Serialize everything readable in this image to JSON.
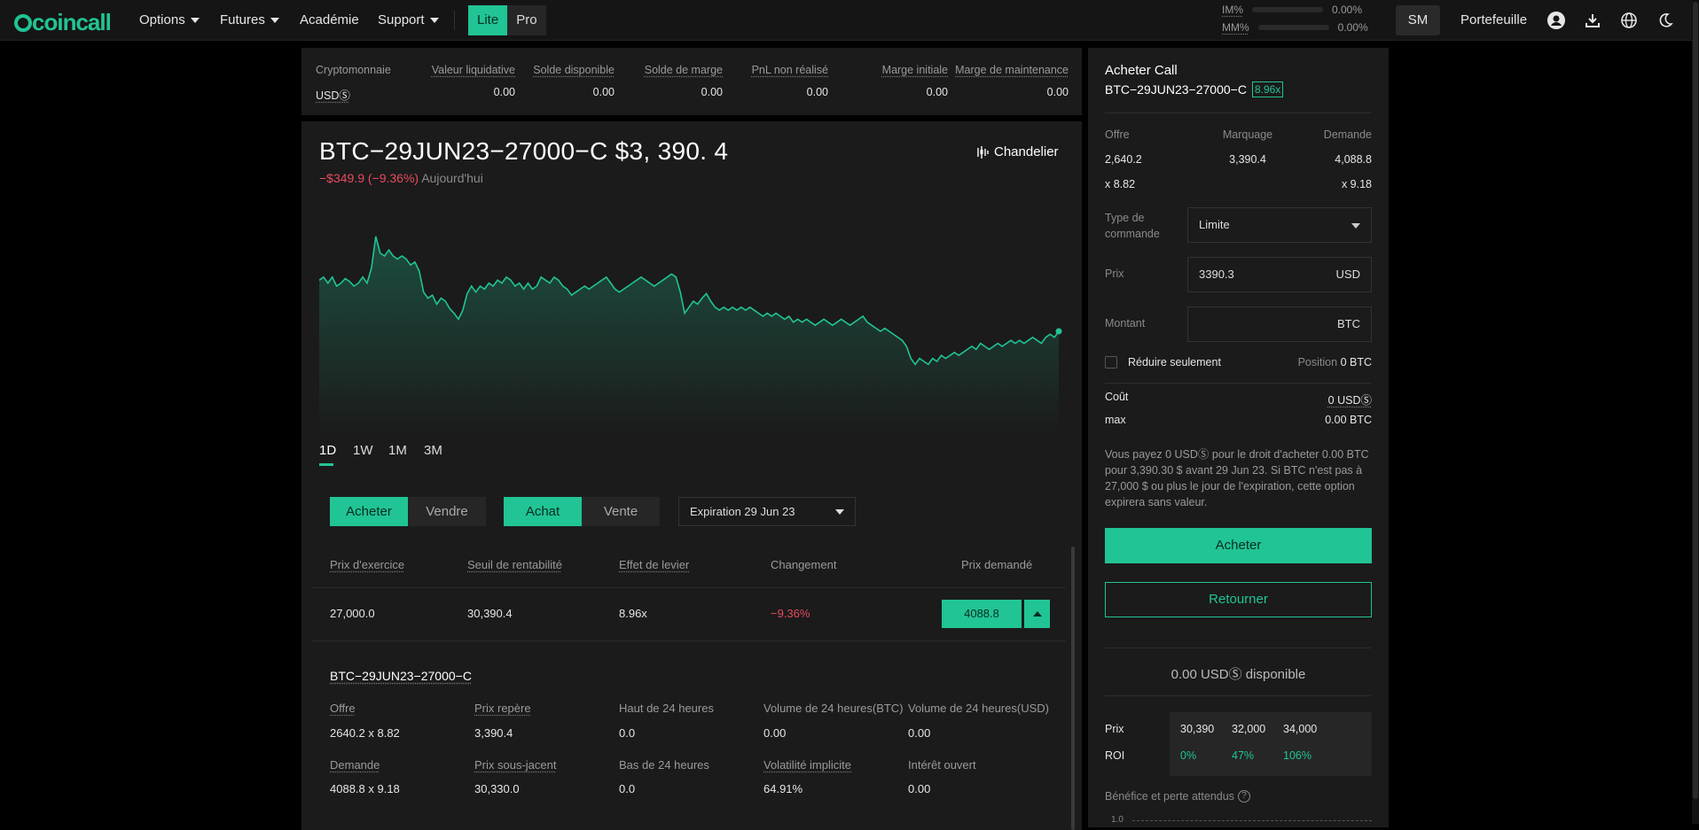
{
  "nav": {
    "brand": "coincall",
    "items": [
      {
        "label": "Options",
        "has_caret": true
      },
      {
        "label": "Futures",
        "has_caret": true
      },
      {
        "label": "Académie",
        "has_caret": false
      },
      {
        "label": "Support",
        "has_caret": true
      }
    ],
    "mode_lite": "Lite",
    "mode_pro": "Pro",
    "im_label": "IM%",
    "im_value": "0.00%",
    "mm_label": "MM%",
    "mm_value": "0.00%",
    "user_initials": "SM",
    "portfolio": "Portefeuille",
    "icons": [
      "user-icon",
      "download-icon",
      "globe-icon",
      "moon-icon"
    ]
  },
  "balances": {
    "headers": [
      "Cryptomonnaie",
      "Valeur liquidative",
      "Solde disponible",
      "Solde de marge",
      "PnL non réalisé",
      "Marge initiale",
      "Marge de maintenance"
    ],
    "values": [
      "USDⓈ",
      "0.00",
      "0.00",
      "0.00",
      "0.00",
      "0.00",
      "0.00"
    ]
  },
  "instrument": {
    "name": "BTC−29JUN23−27000−C",
    "price": "$3, 390. 4",
    "change": "−$349.9 (−9.36%)",
    "change_period": "Aujourd'hui",
    "chart_mode": "Chandelier"
  },
  "chart_data": {
    "type": "area",
    "color": "#21c495",
    "values": [
      0.64,
      0.66,
      0.62,
      0.66,
      0.6,
      0.62,
      0.65,
      0.63,
      0.6,
      0.62,
      0.66,
      0.62,
      0.72,
      0.93,
      0.82,
      0.8,
      0.84,
      0.8,
      0.78,
      0.8,
      0.78,
      0.74,
      0.76,
      0.7,
      0.56,
      0.52,
      0.54,
      0.48,
      0.52,
      0.5,
      0.45,
      0.42,
      0.38,
      0.44,
      0.55,
      0.6,
      0.56,
      0.6,
      0.58,
      0.62,
      0.6,
      0.64,
      0.62,
      0.66,
      0.64,
      0.6,
      0.62,
      0.58,
      0.62,
      0.58,
      0.6,
      0.66,
      0.64,
      0.62,
      0.66,
      0.64,
      0.6,
      0.58,
      0.54,
      0.56,
      0.58,
      0.6,
      0.58,
      0.6,
      0.62,
      0.64,
      0.66,
      0.62,
      0.58,
      0.56,
      0.58,
      0.6,
      0.62,
      0.64,
      0.66,
      0.64,
      0.62,
      0.6,
      0.62,
      0.64,
      0.66,
      0.68,
      0.66,
      0.56,
      0.42,
      0.46,
      0.5,
      0.48,
      0.52,
      0.55,
      0.5,
      0.46,
      0.44,
      0.46,
      0.44,
      0.46,
      0.44,
      0.46,
      0.44,
      0.46,
      0.44,
      0.42,
      0.4,
      0.42,
      0.4,
      0.42,
      0.4,
      0.38,
      0.4,
      0.36,
      0.38,
      0.36,
      0.38,
      0.36,
      0.34,
      0.36,
      0.38,
      0.36,
      0.34,
      0.36,
      0.38,
      0.36,
      0.34,
      0.36,
      0.38,
      0.4,
      0.36,
      0.34,
      0.32,
      0.3,
      0.32,
      0.3,
      0.28,
      0.26,
      0.24,
      0.2,
      0.12,
      0.08,
      0.12,
      0.1,
      0.08,
      0.12,
      0.1,
      0.14,
      0.12,
      0.14,
      0.16,
      0.14,
      0.16,
      0.18,
      0.2,
      0.18,
      0.22,
      0.2,
      0.18,
      0.2,
      0.22,
      0.2,
      0.22,
      0.24,
      0.22,
      0.24,
      0.22,
      0.24,
      0.26,
      0.24,
      0.22,
      0.26,
      0.28,
      0.26,
      0.3
    ],
    "ranges": [
      "1D",
      "1W",
      "1M",
      "3M"
    ],
    "active_range": "1D"
  },
  "trade": {
    "side_buy": "Acheter",
    "side_sell": "Vendre",
    "type_call": "Achat",
    "type_put": "Vente",
    "expiry": "Expiration 29 Jun 23",
    "table_headers": [
      "Prix d'exercice",
      "Seuil de rentabilité",
      "Effet de levier",
      "Changement",
      "Prix demandé"
    ],
    "row": {
      "strike": "27,000.0",
      "breakeven": "30,390.4",
      "leverage": "8.96x",
      "change": "−9.36%",
      "ask": "4088.8"
    }
  },
  "details": {
    "title": "BTC−29JUN23−27000−C",
    "row1": [
      {
        "label": "Offre",
        "value": "2640.2 x 8.82",
        "underline": true
      },
      {
        "label": "Prix repère",
        "value": "3,390.4",
        "underline": true
      },
      {
        "label": "Haut de 24 heures",
        "value": "0.0",
        "underline": false
      },
      {
        "label": "Volume de 24 heures(BTC)",
        "value": "0.00",
        "underline": false
      },
      {
        "label": "Volume de 24 heures(USD)",
        "value": "0.00",
        "underline": false
      }
    ],
    "row2": [
      {
        "label": "Demande",
        "value": "4088.8 x 9.18",
        "underline": true
      },
      {
        "label": "Prix sous-jacent",
        "value": "30,330.0",
        "underline": true
      },
      {
        "label": "Bas de 24 heures",
        "value": "0.0",
        "underline": false
      },
      {
        "label": "Volatilité implicite",
        "value": "64.91%",
        "underline": true
      },
      {
        "label": "Intérêt ouvert",
        "value": "0.00",
        "underline": false
      }
    ]
  },
  "order": {
    "title": "Acheter Call",
    "instrument": "BTC−29JUN23−27000−C",
    "leverage_badge": "8.96x",
    "bid_label": "Offre",
    "mark_label": "Marquage",
    "ask_label": "Demande",
    "bid": "2,640.2",
    "mark": "3,390.4",
    "ask": "4,088.8",
    "bid_size": "x 8.82",
    "ask_size": "x 9.18",
    "order_type_label": "Type de commande",
    "order_type": "Limite",
    "price_label": "Prix",
    "price": "3390.3",
    "price_unit": "USD",
    "amount_label": "Montant",
    "amount_unit": "BTC",
    "reduce_only": "Réduire seulement",
    "position_label": "Position",
    "position_value": "0 BTC",
    "cost_label": "Coût",
    "cost_value": "0 USDⓈ",
    "max_label": "max",
    "max_value": "0.00 BTC",
    "description": "Vous payez 0 USDⓈ pour le droit d'acheter 0.00 BTC pour 3,390.30 $ avant 29 Jun 23. Si BTC n'est pas à 27,000 $ ou plus le jour de l'expiration, cette option expirera sans valeur.",
    "buy_button": "Acheter",
    "back_button": "Retourner",
    "available": "0.00 USDⓈ disponible",
    "roi_price_label": "Prix",
    "roi_label": "ROI",
    "roi_prices": [
      "30,390",
      "32,000",
      "34,000"
    ],
    "roi_values": [
      "0%",
      "47%",
      "106%"
    ],
    "pnl_label": "Bénéfice et perte attendus",
    "pnl_axis_tick": "1.0"
  }
}
